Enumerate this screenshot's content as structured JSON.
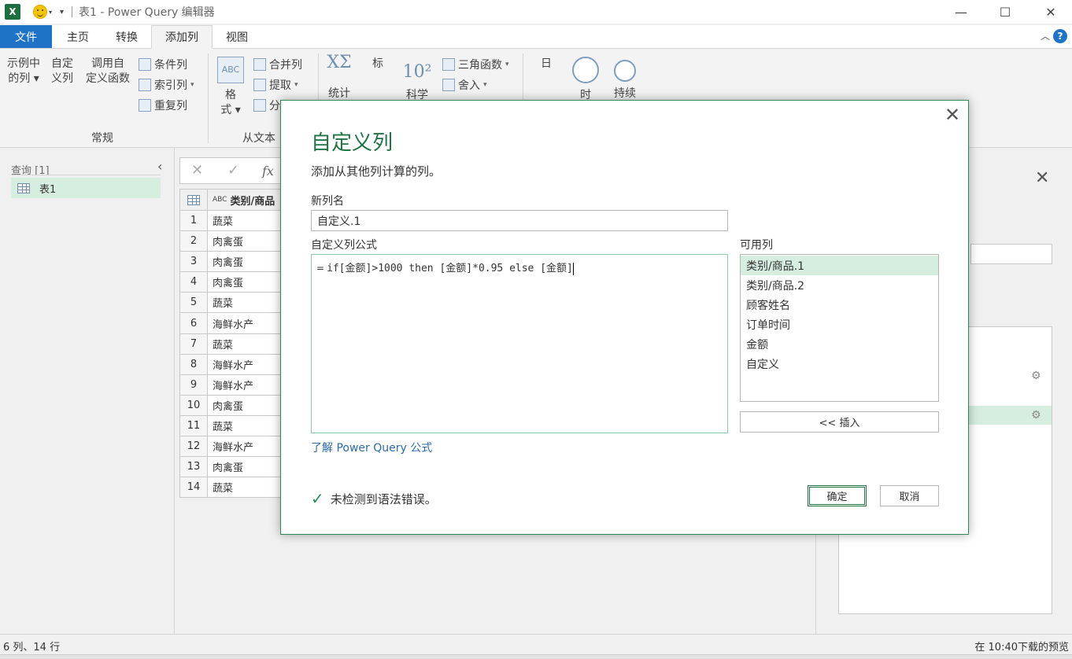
{
  "window": {
    "title": "表1 - Power Query 编辑器",
    "app_logo": "X",
    "minimize_glyph": "—",
    "maximize_glyph": "☐",
    "close_glyph": "✕"
  },
  "tabs": [
    {
      "label": "文件"
    },
    {
      "label": "主页"
    },
    {
      "label": "转换"
    },
    {
      "label": "添加列"
    },
    {
      "label": "视图"
    }
  ],
  "ribbon": {
    "general": {
      "example_line1": "示例中",
      "example_line2": "的列",
      "custom_line1": "自定",
      "custom_line2": "义列",
      "invoke_line1": "调用自",
      "invoke_line2": "定义函数",
      "conditional": "条件列",
      "index": "索引列",
      "duplicate": "重复列",
      "group_label": "常规"
    },
    "from_text": {
      "format_line1": "格",
      "format_line2": "式",
      "merge": "合并列",
      "extract": "提取",
      "parse": "分",
      "group_label": "从文本"
    },
    "from_number": {
      "stats": "统计",
      "standard": "标",
      "scientific": "科学",
      "trig": "三角函数",
      "rounding": "舍入"
    },
    "from_date": {
      "date": "日",
      "time": "时",
      "duration": "持续"
    }
  },
  "queries": {
    "title": "查询 [1]",
    "items": [
      {
        "label": "表1"
      }
    ]
  },
  "grid": {
    "column_header": "类别/商品",
    "rows": [
      {
        "n": "1",
        "v": "蔬菜"
      },
      {
        "n": "2",
        "v": "肉禽蛋"
      },
      {
        "n": "3",
        "v": "肉禽蛋"
      },
      {
        "n": "4",
        "v": "肉禽蛋"
      },
      {
        "n": "5",
        "v": "蔬菜"
      },
      {
        "n": "6",
        "v": "海鲜水产"
      },
      {
        "n": "7",
        "v": "蔬菜"
      },
      {
        "n": "8",
        "v": "海鲜水产"
      },
      {
        "n": "9",
        "v": "海鲜水产"
      },
      {
        "n": "10",
        "v": "肉禽蛋"
      },
      {
        "n": "11",
        "v": "蔬菜"
      },
      {
        "n": "12",
        "v": "海鲜水产"
      },
      {
        "n": "13",
        "v": "肉禽蛋"
      },
      {
        "n": "14",
        "v": "蔬菜"
      }
    ]
  },
  "status": {
    "left": "6 列、14 行",
    "right": "在 10:40下载的预览"
  },
  "dialog": {
    "title": "自定义列",
    "subtitle": "添加从其他列计算的列。",
    "new_column_label": "新列名",
    "new_column_value": "自定义.1",
    "formula_label": "自定义列公式",
    "formula_prefix": "=",
    "formula": "if[金额]>1000 then [金额]*0.95 else [金额]",
    "available_label": "可用列",
    "available_columns": [
      {
        "label": "类别/商品.1"
      },
      {
        "label": "类别/商品.2"
      },
      {
        "label": "顾客姓名"
      },
      {
        "label": "订单时间"
      },
      {
        "label": "金额"
      },
      {
        "label": "自定义"
      }
    ],
    "insert_button": "<< 插入",
    "learn_link": "了解 Power Query 公式",
    "syntax_status": "未检测到语法错误。",
    "ok_button": "确定",
    "cancel_button": "取消"
  }
}
